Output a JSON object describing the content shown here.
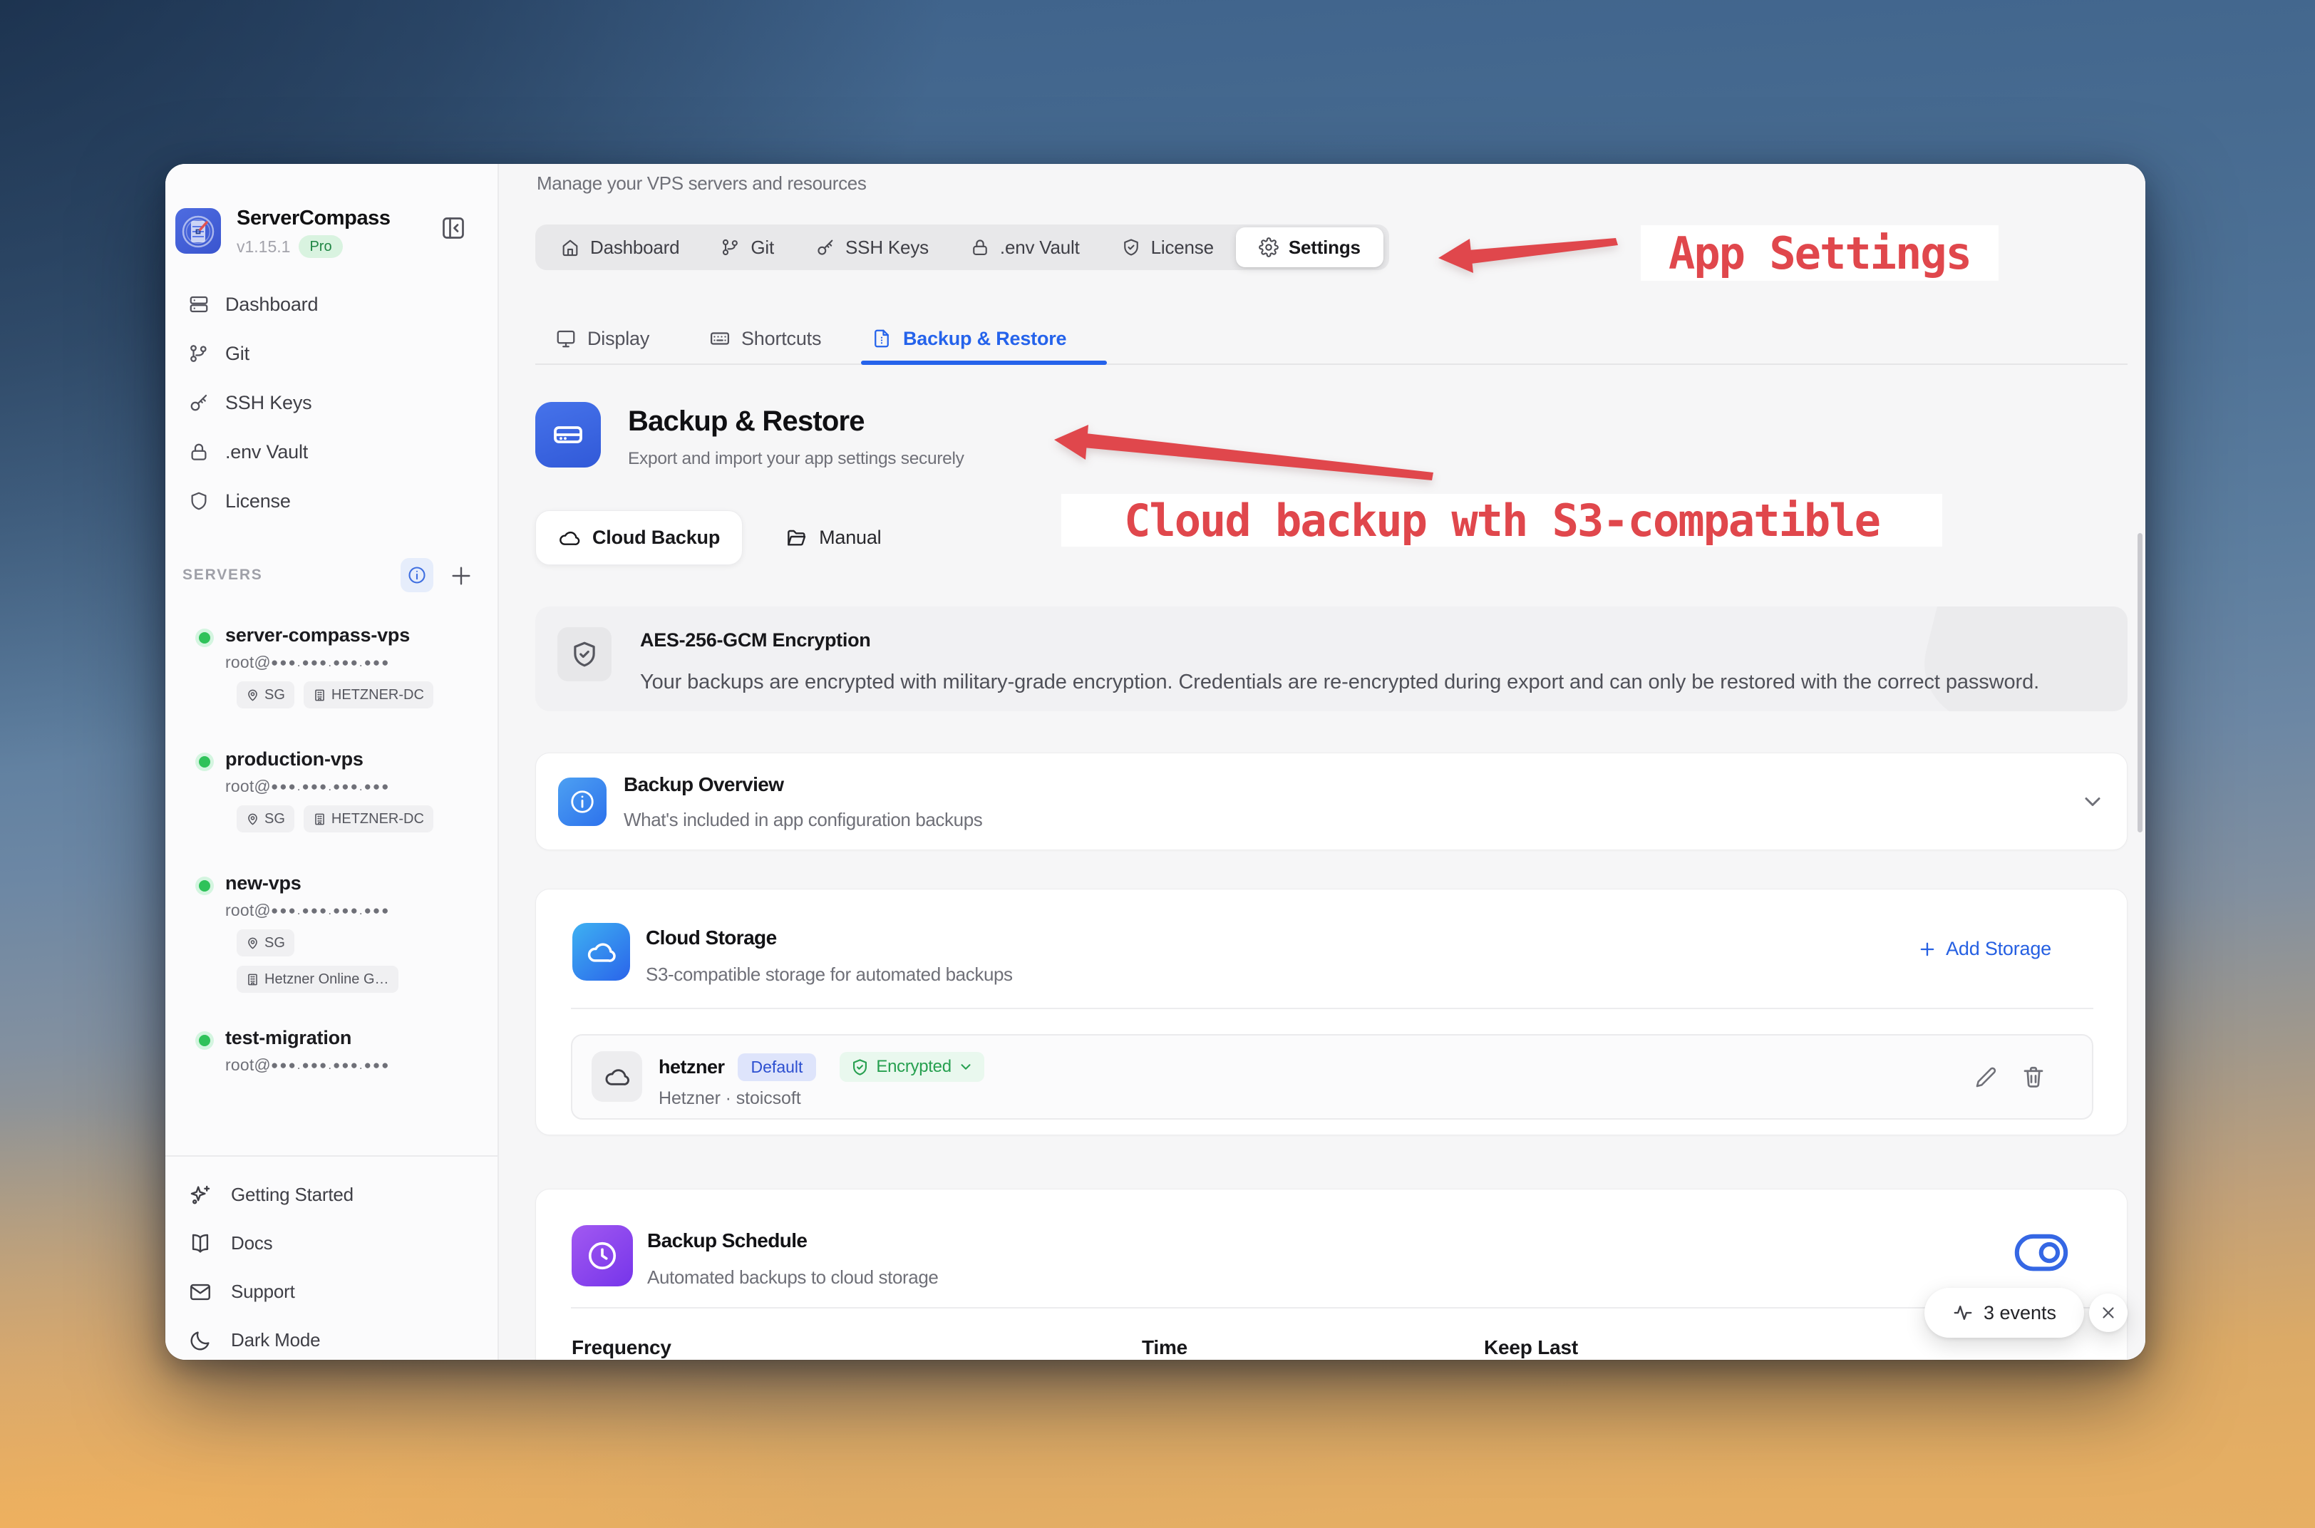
{
  "sidebar": {
    "brand": {
      "name": "ServerCompass",
      "version": "v1.15.1",
      "badge": "Pro"
    },
    "nav": [
      {
        "label": "Dashboard"
      },
      {
        "label": "Git"
      },
      {
        "label": "SSH Keys"
      },
      {
        "label": ".env Vault"
      },
      {
        "label": "License"
      }
    ],
    "servers_label": "SERVERS",
    "servers": [
      {
        "name": "server-compass-vps",
        "host_prefix": "root@",
        "host_mask": "●●●.●●●.●●●.●●●",
        "badge1": "SG",
        "badge2": "HETZNER-DC"
      },
      {
        "name": "production-vps",
        "host_prefix": "root@",
        "host_mask": "●●●.●●●.●●●.●●●",
        "badge1": "SG",
        "badge2": "HETZNER-DC"
      },
      {
        "name": "new-vps",
        "host_prefix": "root@",
        "host_mask": "●●●.●●●.●●●.●●●",
        "badge1": "SG",
        "badge2": "Hetzner Online G…"
      },
      {
        "name": "test-migration",
        "host_prefix": "root@",
        "host_mask": "●●●.●●●.●●●.●●●"
      }
    ],
    "footer": [
      {
        "label": "Getting Started"
      },
      {
        "label": "Docs"
      },
      {
        "label": "Support"
      },
      {
        "label": "Dark Mode"
      }
    ]
  },
  "main": {
    "subtitle": "Manage your VPS servers and resources",
    "top_tabs": [
      {
        "label": "Dashboard"
      },
      {
        "label": "Git"
      },
      {
        "label": "SSH Keys"
      },
      {
        "label": ".env Vault"
      },
      {
        "label": "License"
      },
      {
        "label": "Settings"
      }
    ],
    "sub_tabs": [
      {
        "label": "Display"
      },
      {
        "label": "Shortcuts"
      },
      {
        "label": "Backup & Restore"
      }
    ],
    "section": {
      "title": "Backup & Restore",
      "subtitle": "Export and import your app settings securely"
    },
    "mode_buttons": [
      {
        "label": "Cloud Backup"
      },
      {
        "label": "Manual"
      }
    ],
    "banner": {
      "title": "AES-256-GCM Encryption",
      "body": "Your backups are encrypted with military-grade encryption. Credentials are re-encrypted during export and can only be restored with the correct password."
    },
    "overview": {
      "title": "Backup Overview",
      "subtitle": "What's included in app configuration backups"
    },
    "storage": {
      "title": "Cloud Storage",
      "subtitle": "S3-compatible storage for automated backups",
      "action": "Add Storage",
      "item": {
        "name": "hetzner",
        "badge": "Default",
        "status": "Encrypted",
        "meta": "Hetzner · stoicsoft"
      }
    },
    "schedule": {
      "title": "Backup Schedule",
      "subtitle": "Automated backups to cloud storage",
      "col1": "Frequency",
      "col2": "Time",
      "col3": "Keep Last"
    }
  },
  "annotations": {
    "settings": "App Settings",
    "cloud": "Cloud backup wth S3-compatible"
  },
  "events": {
    "label": "3 events"
  },
  "colors": {
    "accent_blue": "#2962e0",
    "annotation_red": "#e23e41",
    "green_status": "#27a050"
  }
}
